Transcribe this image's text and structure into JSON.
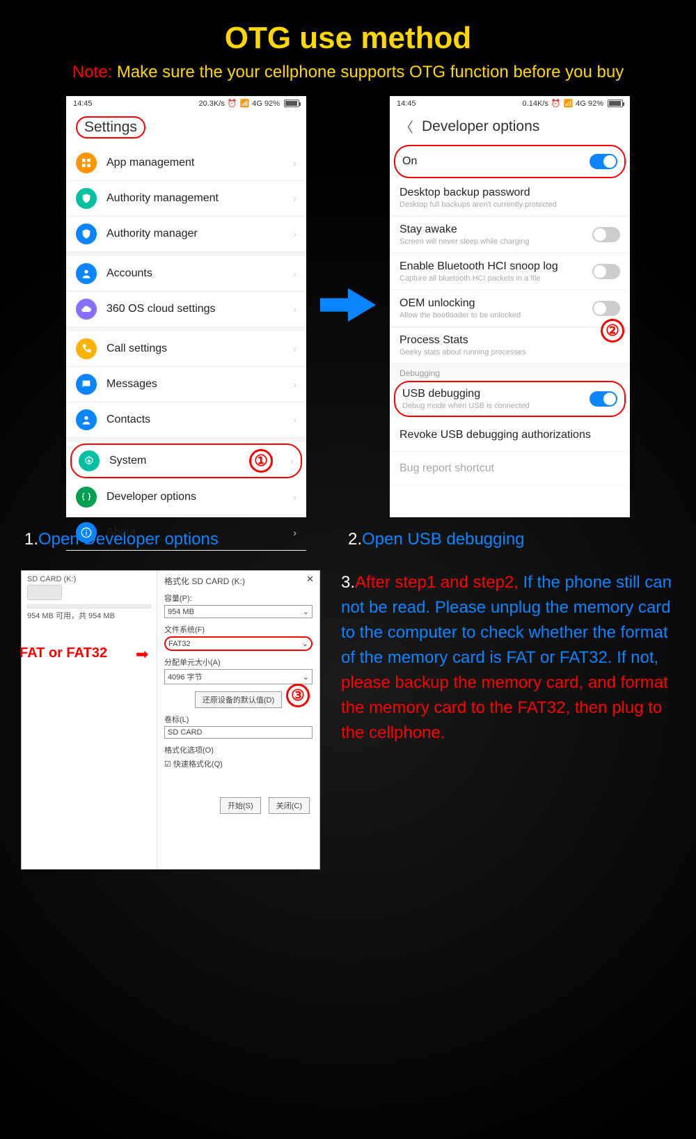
{
  "title": "OTG use method",
  "note_prefix": "Note:",
  "note_body": "Make sure the your cellphone supports OTG function before you buy",
  "status": {
    "time": "14:45",
    "speed1": "20.3K/s",
    "speed2": "0.14K/s",
    "net": "4G 92%"
  },
  "phone1": {
    "title": "Settings",
    "items": [
      {
        "label": "App management",
        "color": "#ff9500",
        "icon": "grid"
      },
      {
        "label": "Authority management",
        "color": "#00c0a0",
        "icon": "shield"
      },
      {
        "label": "Authority manager",
        "color": "#0b84ff",
        "icon": "shield"
      }
    ],
    "items2": [
      {
        "label": "Accounts",
        "color": "#0b84ff",
        "icon": "user"
      },
      {
        "label": "360 OS cloud settings",
        "color": "#8a6eff",
        "icon": "cloud"
      }
    ],
    "items3": [
      {
        "label": "Call settings",
        "color": "#ffb300",
        "icon": "phone"
      },
      {
        "label": "Messages",
        "color": "#0b84ff",
        "icon": "msg"
      },
      {
        "label": "Contacts",
        "color": "#0b84ff",
        "icon": "user"
      }
    ],
    "items4": [
      {
        "label": "System",
        "color": "#00c0a0",
        "icon": "gear",
        "circled": true,
        "badge": "①"
      },
      {
        "label": "Developer options",
        "color": "#00a050",
        "icon": "braces"
      },
      {
        "label": "About",
        "color": "#0b84ff",
        "icon": "info"
      }
    ]
  },
  "phone2": {
    "title": "Developer options",
    "rows": [
      {
        "title": "On",
        "toggle": true,
        "on": true,
        "circled": true
      },
      {
        "title": "Desktop backup password",
        "sub": "Desktop full backups aren't currently protected"
      },
      {
        "title": "Stay awake",
        "sub": "Screen will never sleep while charging",
        "toggle": true
      },
      {
        "title": "Enable Bluetooth HCI snoop log",
        "sub": "Capture all bluetooth HCI packets in a file",
        "toggle": true
      },
      {
        "title": "OEM unlocking",
        "sub": "Allow the bootloader to be unlocked",
        "toggle": true
      },
      {
        "title": "Process Stats",
        "sub": "Geeky stats about running processes",
        "badge": "②"
      }
    ],
    "debug_label": "Debugging",
    "debug_rows": [
      {
        "title": "USB debugging",
        "sub": "Debug mode when USB is connected",
        "toggle": true,
        "on": true,
        "circled": true
      },
      {
        "title": "Revoke USB debugging authorizations"
      },
      {
        "title": "Bug report shortcut",
        "faded": true
      }
    ]
  },
  "caption1_num": "1.",
  "caption1": "Open Developer options",
  "caption2_num": "2.",
  "caption2": "Open USB debugging",
  "fat_label": "FAT or FAT32",
  "win": {
    "left_title": "SD CARD (K:)",
    "left_sub": "954 MB 可用，共 954 MB",
    "right_title": "格式化 SD CARD (K:)",
    "cap_label": "容量(P):",
    "cap_val": "954 MB",
    "fs_label": "文件系统(F)",
    "fs_val": "FAT32",
    "au_label": "分配单元大小(A)",
    "au_val": "4096 字节",
    "restore_btn": "还原设备的默认值(D)",
    "vol_label": "卷标(L)",
    "vol_val": "SD CARD",
    "opt_label": "格式化选项(O)",
    "quick": "快速格式化(Q)",
    "start": "开始(S)",
    "close": "关闭(C)",
    "badge": "③"
  },
  "step3_num": "3.",
  "step3_red1": "After step1 and step2,",
  "step3_blue1": "If the phone still can not be read. Please unplug the memory card to the computer to check whether the format of the memory card is FAT or FAT32. If not,",
  "step3_red2": "please backup the memory card, and format the memory card to the FAT32, then plug to the cellphone."
}
